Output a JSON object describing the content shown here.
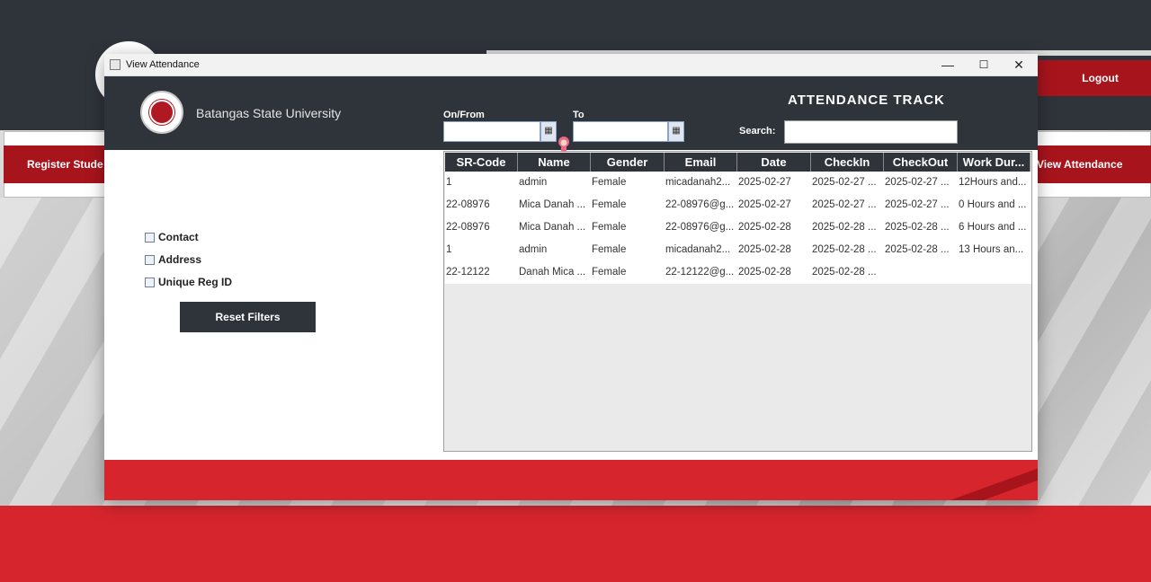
{
  "background": {
    "tab_left": "Register Stude",
    "tab_right": "View Attendance",
    "logout": "Logout"
  },
  "window": {
    "title": "View Attendance",
    "minimize": "—",
    "maximize": "☐",
    "close": "✕"
  },
  "header": {
    "university": "Batangas State University",
    "title": "ATTENDANCE TRACK",
    "from_label": "On/From",
    "to_label": "To",
    "search_label": "Search:",
    "from_value": "",
    "to_value": "",
    "search_value": ""
  },
  "filters": {
    "items": [
      {
        "label": "Contact",
        "checked": false
      },
      {
        "label": "Address",
        "checked": false
      },
      {
        "label": "Unique Reg ID",
        "checked": false
      }
    ],
    "reset_label": "Reset Filters"
  },
  "table": {
    "columns": [
      "SR-Code",
      "Name",
      "Gender",
      "Email",
      "Date",
      "CheckIn",
      "CheckOut",
      "Work Dur..."
    ],
    "rows": [
      [
        "1",
        "admin",
        "Female",
        "micadanah2...",
        "2025-02-27",
        "2025-02-27 ...",
        "2025-02-27 ...",
        "12Hours and..."
      ],
      [
        "22-08976",
        "Mica Danah ...",
        "Female",
        "22-08976@g...",
        "2025-02-27",
        "2025-02-27 ...",
        "2025-02-27 ...",
        "0 Hours and ..."
      ],
      [
        "22-08976",
        "Mica Danah ...",
        "Female",
        "22-08976@g...",
        "2025-02-28",
        "2025-02-28 ...",
        "2025-02-28 ...",
        "6 Hours and ..."
      ],
      [
        "1",
        "admin",
        "Female",
        "micadanah2...",
        "2025-02-28",
        "2025-02-28 ...",
        "2025-02-28 ...",
        "13 Hours an..."
      ],
      [
        "22-12122",
        "Danah Mica ...",
        "Female",
        "22-12122@g...",
        "2025-02-28",
        "2025-02-28 ...",
        "",
        ""
      ]
    ]
  },
  "colors": {
    "header_dark": "#2f333a",
    "brand_red": "#d7252d",
    "tab_red": "#a8141c"
  }
}
